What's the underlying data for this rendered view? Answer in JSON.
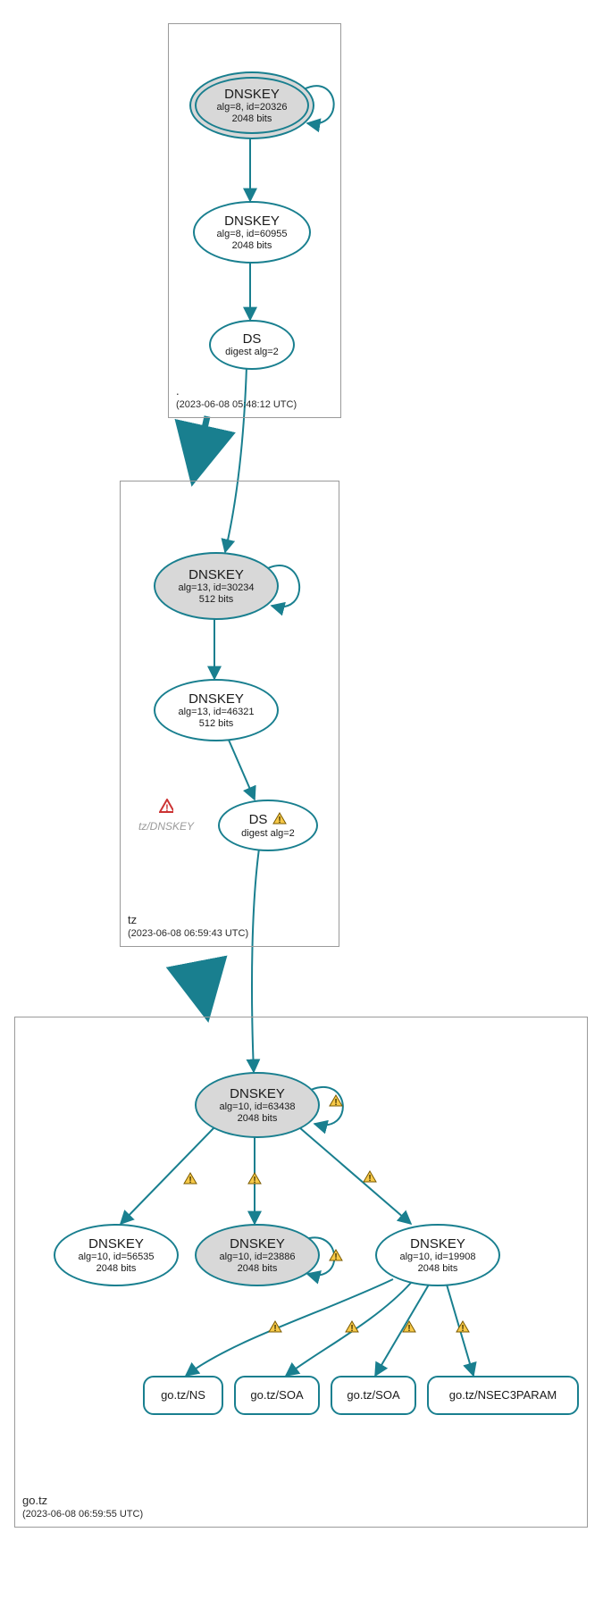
{
  "colors": {
    "stroke": "#197f8f",
    "frame": "#9a9a9a",
    "warnYellow": "#f7c948",
    "warnRed": "#cc3333",
    "warnEdge": "#7a5a00",
    "warnRedEdge": "#8a1f1f"
  },
  "zones": {
    "root": {
      "title": ".",
      "timestamp": "(2023-06-08 05:48:12 UTC)"
    },
    "tz": {
      "title": "tz",
      "timestamp": "(2023-06-08 06:59:43 UTC)"
    },
    "gotz": {
      "title": "go.tz",
      "timestamp": "(2023-06-08 06:59:55 UTC)"
    }
  },
  "nodes": {
    "root_ksk": {
      "t1": "DNSKEY",
      "t2": "alg=8, id=20326",
      "t3": "2048 bits"
    },
    "root_zsk": {
      "t1": "DNSKEY",
      "t2": "alg=8, id=60955",
      "t3": "2048 bits"
    },
    "root_ds": {
      "t1": "DS",
      "t2": "digest alg=2"
    },
    "tz_ksk": {
      "t1": "DNSKEY",
      "t2": "alg=13, id=30234",
      "t3": "512 bits"
    },
    "tz_zsk": {
      "t1": "DNSKEY",
      "t2": "alg=13, id=46321",
      "t3": "512 bits"
    },
    "tz_ds": {
      "t1": "DS",
      "t2": "digest alg=2"
    },
    "gotz_ksk": {
      "t1": "DNSKEY",
      "t2": "alg=10, id=63438",
      "t3": "2048 bits"
    },
    "gotz_k1": {
      "t1": "DNSKEY",
      "t2": "alg=10, id=56535",
      "t3": "2048 bits"
    },
    "gotz_k2": {
      "t1": "DNSKEY",
      "t2": "alg=10, id=23886",
      "t3": "2048 bits"
    },
    "gotz_k3": {
      "t1": "DNSKEY",
      "t2": "alg=10, id=19908",
      "t3": "2048 bits"
    },
    "rr_ns": {
      "t1": "go.tz/NS"
    },
    "rr_soa1": {
      "t1": "go.tz/SOA"
    },
    "rr_soa2": {
      "t1": "go.tz/SOA"
    },
    "rr_nsec3": {
      "t1": "go.tz/NSEC3PARAM"
    }
  },
  "ghost": {
    "tz_dnskey": "tz/DNSKEY"
  }
}
